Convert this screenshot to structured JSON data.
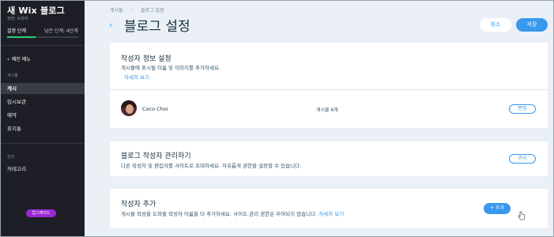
{
  "sidebar": {
    "site_title": "새 Wix 블로그",
    "role": "권한: 소유자",
    "step_label": "설정 단계",
    "steps_left": "남은 단계: 4단계",
    "progress_fraction": 0.4,
    "back_label": "메인 메뉴",
    "section_posts": "게시물",
    "items": [
      {
        "label": "게시"
      },
      {
        "label": "임시보관"
      },
      {
        "label": "예약"
      },
      {
        "label": "휴지통"
      }
    ],
    "section_manage": "관리",
    "category_label": "카테고리",
    "upgrade_label": "업그레이드"
  },
  "header": {
    "breadcrumb": [
      "게시물",
      "블로그 설정"
    ],
    "title": "블로그 설정",
    "cancel_label": "취소",
    "save_label": "저장"
  },
  "author_info": {
    "title": "작성자 정보 설정",
    "description": "게시물에 표시될 이름 및 이미지를 추가하세요.",
    "learn_more": "자세히 보기"
  },
  "author_row": {
    "name": "Coco Choi",
    "posts": "게시물 6개",
    "edit_label": "편집"
  },
  "writers_manage": {
    "title": "블로그 작성자 관리하기",
    "description": "다른 작성자 및 편집자를 사이트로 초대하세요. 자유롭게 권한을 설정할 수 있습니다.",
    "manage_label": "관리"
  },
  "add_writer": {
    "title": "작성자 추가",
    "description": "게시물 작성을 도와줄 작성자 이름을 더 추가하세요. 사이트 관리 권한은 부여되지 않습니다.",
    "learn_more": "자세히 보기",
    "add_label": "+ 추가"
  },
  "colors": {
    "accent": "#3899ec",
    "sidebar_bg": "#1e1f26",
    "upgrade": "#9a27d5",
    "progress": "#2ecc71"
  }
}
